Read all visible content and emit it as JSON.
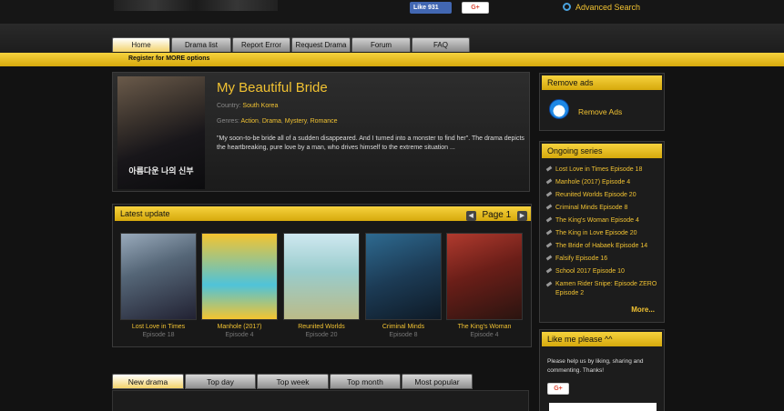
{
  "header": {
    "fb_like_label": "Like 931",
    "gplus_label": "G+",
    "advanced_search_label": "Advanced Search"
  },
  "nav": {
    "tabs": [
      {
        "label": "Home",
        "active": true
      },
      {
        "label": "Drama list",
        "active": false
      },
      {
        "label": "Report Error",
        "active": false
      },
      {
        "label": "Request Drama",
        "active": false
      },
      {
        "label": "Forum",
        "active": false
      },
      {
        "label": "FAQ",
        "active": false
      }
    ],
    "register_text": "Register for MORE options"
  },
  "featured": {
    "title": "My Beautiful Bride",
    "country_label": "Country:",
    "country": "South Korea",
    "genres_label": "Genres:",
    "genres": [
      "Action",
      "Drama",
      "Mystery",
      "Romance"
    ],
    "description": "\"My soon-to-be bride all of a sudden disappeared. And I turned into a monster to find her\". The drama depicts the heartbreaking, pure love by a man, who drives himself to the extreme situation ...",
    "poster_text": "아름다운 나의 신부"
  },
  "latest": {
    "header": "Latest update",
    "page_label": "Page 1",
    "items": [
      {
        "title": "Lost Love in Times",
        "episode": "Episode 18"
      },
      {
        "title": "Manhole (2017)",
        "episode": "Episode 4"
      },
      {
        "title": "Reunited Worlds",
        "episode": "Episode 20"
      },
      {
        "title": "Criminal Minds",
        "episode": "Episode 8"
      },
      {
        "title": "The King's Woman",
        "episode": "Episode 4"
      }
    ]
  },
  "bottom_tabs": [
    {
      "label": "New drama",
      "active": true
    },
    {
      "label": "Top day",
      "active": false
    },
    {
      "label": "Top week",
      "active": false
    },
    {
      "label": "Top month",
      "active": false
    },
    {
      "label": "Most popular",
      "active": false
    }
  ],
  "sidebar": {
    "remove_ads": {
      "header": "Remove ads",
      "label": "Remove Ads"
    },
    "ongoing": {
      "header": "Ongoing series",
      "items": [
        "Lost Love in Times Episode 18",
        "Manhole (2017) Episode 4",
        "Reunited Worlds Episode 20",
        "Criminal Minds Episode 8",
        "The King's Woman Episode 4",
        "The King in Love Episode 20",
        "The Bride of Habaek Episode 14",
        "Falsify Episode 16",
        "School 2017 Episode 10",
        "Kamen Rider Snipe: Episode ZERO Episode 2"
      ],
      "more_label": "More..."
    },
    "like_me": {
      "header": "Like me please ^^",
      "text": "Please help us by liking, sharing and commenting. Thanks!",
      "gplus_label": "G+"
    }
  },
  "colors": {
    "accent": "#f1c232",
    "background": "#121212",
    "bar": "#e8c020"
  }
}
